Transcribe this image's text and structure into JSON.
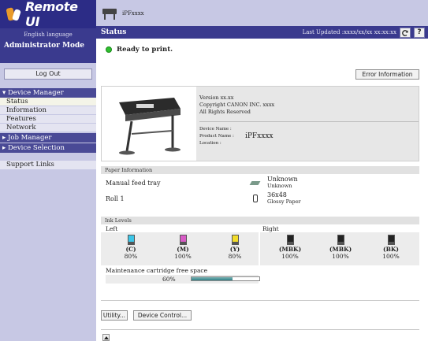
{
  "app": {
    "logo_text": "Remote UI",
    "model_name": "iPFxxxx"
  },
  "sidebar": {
    "language_link": "English language",
    "mode_label": "Administrator Mode",
    "logout_label": "Log Out",
    "device_manager": {
      "header": "▾ Device Manager",
      "items": [
        {
          "label": "Status"
        },
        {
          "label": "Information"
        },
        {
          "label": "Features"
        },
        {
          "label": "Network"
        }
      ]
    },
    "job_manager": "▸ Job Manager",
    "device_selection": "▸ Device Selection",
    "support_links": "Support Links"
  },
  "titlebar": {
    "title": "Status",
    "last_updated": "Last Updated :xxxx/xx/xx xx:xx:xx",
    "refresh_icon": "refresh-icon",
    "help_label": "?"
  },
  "status": {
    "ready_text": "Ready to print.",
    "error_info_button": "Error Information"
  },
  "device": {
    "version": "Version xx.xx",
    "copyright": "Copyright CANON INC. xxxx",
    "rights": "All Rights Reserved",
    "device_name_label": "Device Name :",
    "device_name_value": "",
    "product_name_label": "Product Name :",
    "product_name_value": "iPFxxxx",
    "location_label": "Location :",
    "location_value": ""
  },
  "paper": {
    "section_title": "Paper Information",
    "manual_feed": {
      "label": "Manual feed tray",
      "type": "Unknown",
      "detail": "Unknown"
    },
    "roll1": {
      "label": "Roll 1",
      "size": "36x48",
      "media": "Glossy Paper"
    }
  },
  "ink": {
    "section_title": "Ink Levels",
    "left_label": "Left",
    "right_label": "Right",
    "left": [
      {
        "label": "(C)",
        "percent": "80%",
        "color": "#3cc6e8"
      },
      {
        "label": "(M)",
        "percent": "100%",
        "color": "#d85bc6"
      },
      {
        "label": "(Y)",
        "percent": "80%",
        "color": "#f2dc2a"
      }
    ],
    "right": [
      {
        "label": "(MBK)",
        "percent": "100%",
        "color": "#222222"
      },
      {
        "label": "(MBK)",
        "percent": "100%",
        "color": "#222222"
      },
      {
        "label": "(BK)",
        "percent": "100%",
        "color": "#222222"
      }
    ]
  },
  "maintenance": {
    "label": "Maintenance cartridge free space",
    "percent_text": "60%",
    "level": 0.6
  },
  "buttons": {
    "utility": "Utility...",
    "device_control": "Device Control..."
  },
  "colors": {
    "nav_dark": "#3a3a8e",
    "nav_light": "#c7c8e4",
    "ready_green": "#2fbf2f"
  }
}
